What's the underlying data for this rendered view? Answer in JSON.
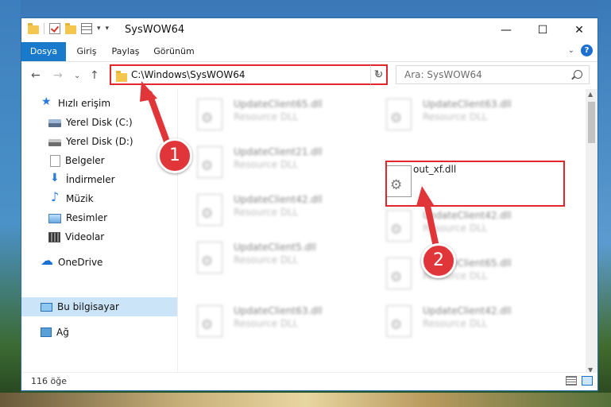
{
  "window": {
    "title": "SysWOW64"
  },
  "ribbon": {
    "tabs": [
      "Dosya",
      "Giriş",
      "Paylaş",
      "Görünüm"
    ]
  },
  "address": {
    "path": "C:\\Windows\\SysWOW64"
  },
  "search": {
    "placeholder": "Ara: SysWOW64"
  },
  "sidebar": {
    "items": [
      {
        "label": "Hızlı erişim",
        "icon": "star-icon"
      },
      {
        "label": "Yerel Disk (C:)",
        "icon": "disk-icon"
      },
      {
        "label": "Yerel Disk (D:)",
        "icon": "disk-icon"
      },
      {
        "label": "Belgeler",
        "icon": "documents-icon"
      },
      {
        "label": "İndirmeler",
        "icon": "download-icon"
      },
      {
        "label": "Müzik",
        "icon": "music-icon"
      },
      {
        "label": "Resimler",
        "icon": "pictures-icon"
      },
      {
        "label": "Videolar",
        "icon": "videos-icon"
      },
      {
        "label": "OneDrive",
        "icon": "cloud-icon"
      },
      {
        "label": "Bu bilgisayar",
        "icon": "computer-icon"
      },
      {
        "label": "Ağ",
        "icon": "network-icon"
      }
    ]
  },
  "files": [
    {
      "name": "UpdateClient65.dll",
      "desc": "Resource DLL"
    },
    {
      "name": "UpdateClient63.dll",
      "desc": "Resource DLL"
    },
    {
      "name": "UpdateClient21.dll",
      "desc": "Resource DLL"
    },
    {
      "name": "out_xf.dll",
      "desc": ""
    },
    {
      "name": "UpdateClient42.dll",
      "desc": "Resource DLL"
    },
    {
      "name": "UpdateClient42.dll",
      "desc": "Resource DLL"
    },
    {
      "name": "UpdateClient5.dll",
      "desc": "Resource DLL"
    },
    {
      "name": "UpdateClient65.dll",
      "desc": "Resource DLL"
    },
    {
      "name": "UpdateClient63.dll",
      "desc": "Resource DLL"
    },
    {
      "name": "UpdateClient42.dll",
      "desc": "Resource DLL"
    }
  ],
  "status": {
    "count": "116 öğe"
  },
  "annotations": {
    "step1": "1",
    "step2": "2"
  },
  "colors": {
    "highlight": "#e2262c",
    "accent": "#1979ca",
    "selected": "#cce4f7"
  }
}
